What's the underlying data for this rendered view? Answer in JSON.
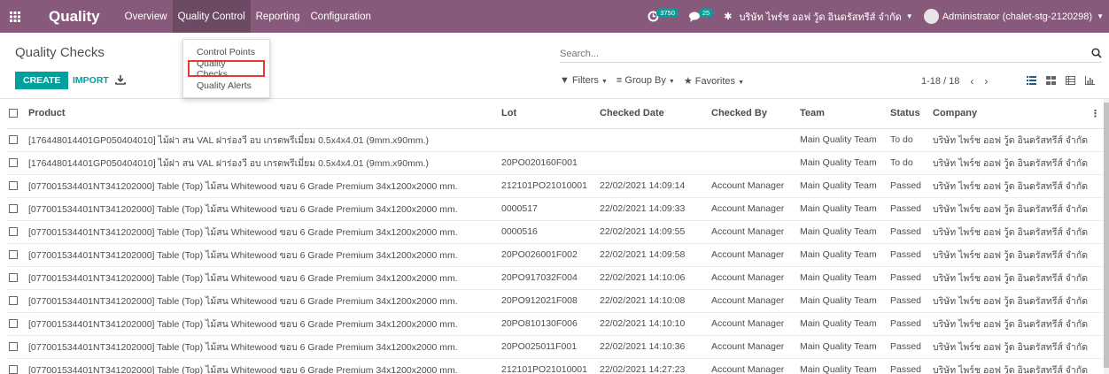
{
  "topbar": {
    "app_name": "Quality",
    "menu": [
      "Overview",
      "Quality Control",
      "Reporting",
      "Configuration"
    ],
    "activity_count": "3750",
    "message_count": "25",
    "company": "บริษัท ไพร์ช ออฟ วู้ด อินดรัสทรีส์ จำกัด",
    "user": "Administrator (chalet-stg-2120298)"
  },
  "control_panel": {
    "title": "Quality Checks",
    "create_label": "CREATE",
    "import_label": "IMPORT",
    "search_placeholder": "Search...",
    "filters_label": "Filters",
    "groupby_label": "Group By",
    "favorites_label": "Favorites",
    "pager": "1-18 / 18"
  },
  "dropdown": {
    "items": [
      "Control Points",
      "Quality Checks",
      "Quality Alerts"
    ]
  },
  "table": {
    "headers": [
      "Product",
      "Lot",
      "Checked Date",
      "Checked By",
      "Team",
      "Status",
      "Company"
    ],
    "rows": [
      [
        "[176448014401GP050404010] ไม้ฝา สน VAL ฝาร่องวี อบ เกรดพรีเมี่ยม 0.5x4x4.01 (9mm.x90mm.)",
        "",
        "",
        "",
        "Main Quality Team",
        "To do",
        "บริษัท ไพร์ช ออฟ วู้ด อินดรัสทรีส์ จำกัด"
      ],
      [
        "[176448014401GP050404010] ไม้ฝา สน VAL ฝาร่องวี อบ เกรดพรีเมี่ยม 0.5x4x4.01 (9mm.x90mm.)",
        "20PO020160F001",
        "",
        "",
        "Main Quality Team",
        "To do",
        "บริษัท ไพร์ช ออฟ วู้ด อินดรัสทรีส์ จำกัด"
      ],
      [
        "[077001534401NT341202000] Table (Top) ไม้สน Whitewood ขอบ 6 Grade Premium 34x1200x2000 mm.",
        "212101PO21010001",
        "22/02/2021 14:09:14",
        "Account Manager",
        "Main Quality Team",
        "Passed",
        "บริษัท ไพร์ช ออฟ วู้ด อินดรัสทรีส์ จำกัด"
      ],
      [
        "[077001534401NT341202000] Table (Top) ไม้สน Whitewood ขอบ 6 Grade Premium 34x1200x2000 mm.",
        "0000517",
        "22/02/2021 14:09:33",
        "Account Manager",
        "Main Quality Team",
        "Passed",
        "บริษัท ไพร์ช ออฟ วู้ด อินดรัสทรีส์ จำกัด"
      ],
      [
        "[077001534401NT341202000] Table (Top) ไม้สน Whitewood ขอบ 6 Grade Premium 34x1200x2000 mm.",
        "0000516",
        "22/02/2021 14:09:55",
        "Account Manager",
        "Main Quality Team",
        "Passed",
        "บริษัท ไพร์ช ออฟ วู้ด อินดรัสทรีส์ จำกัด"
      ],
      [
        "[077001534401NT341202000] Table (Top) ไม้สน Whitewood ขอบ 6 Grade Premium 34x1200x2000 mm.",
        "20PO026001F002",
        "22/02/2021 14:09:58",
        "Account Manager",
        "Main Quality Team",
        "Passed",
        "บริษัท ไพร์ช ออฟ วู้ด อินดรัสทรีส์ จำกัด"
      ],
      [
        "[077001534401NT341202000] Table (Top) ไม้สน Whitewood ขอบ 6 Grade Premium 34x1200x2000 mm.",
        "20PO917032F004",
        "22/02/2021 14:10:06",
        "Account Manager",
        "Main Quality Team",
        "Passed",
        "บริษัท ไพร์ช ออฟ วู้ด อินดรัสทรีส์ จำกัด"
      ],
      [
        "[077001534401NT341202000] Table (Top) ไม้สน Whitewood ขอบ 6 Grade Premium 34x1200x2000 mm.",
        "20PO912021F008",
        "22/02/2021 14:10:08",
        "Account Manager",
        "Main Quality Team",
        "Passed",
        "บริษัท ไพร์ช ออฟ วู้ด อินดรัสทรีส์ จำกัด"
      ],
      [
        "[077001534401NT341202000] Table (Top) ไม้สน Whitewood ขอบ 6 Grade Premium 34x1200x2000 mm.",
        "20PO810130F006",
        "22/02/2021 14:10:10",
        "Account Manager",
        "Main Quality Team",
        "Passed",
        "บริษัท ไพร์ช ออฟ วู้ด อินดรัสทรีส์ จำกัด"
      ],
      [
        "[077001534401NT341202000] Table (Top) ไม้สน Whitewood ขอบ 6 Grade Premium 34x1200x2000 mm.",
        "20PO025011F001",
        "22/02/2021 14:10:36",
        "Account Manager",
        "Main Quality Team",
        "Passed",
        "บริษัท ไพร์ช ออฟ วู้ด อินดรัสทรีส์ จำกัด"
      ],
      [
        "[077001534401NT341202000] Table (Top) ไม้สน Whitewood ขอบ 6 Grade Premium 34x1200x2000 mm.",
        "212101PO21010001",
        "22/02/2021 14:27:23",
        "Account Manager",
        "Main Quality Team",
        "Passed",
        "บริษัท ไพร์ช ออฟ วู้ด อินดรัสทรีส์ จำกัด"
      ]
    ]
  },
  "colors": {
    "brand": "#875a7b",
    "accent": "#00a09d",
    "highlight_box": "#e53935"
  }
}
